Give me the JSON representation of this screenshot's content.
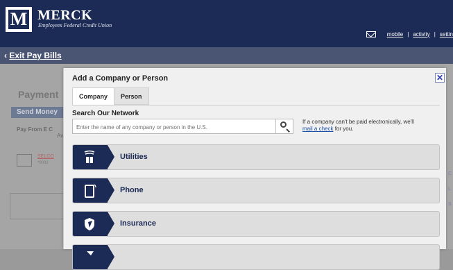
{
  "header": {
    "brand_name": "MERCK",
    "brand_sub": "Employees Federal Credit Union",
    "logo_letter": "M",
    "links": [
      "mobile",
      "activity",
      "settin"
    ],
    "colors": {
      "navy": "#1c2b55",
      "subbar": "#4a5573"
    }
  },
  "subbar": {
    "exit_label": "Exit Pay Bills"
  },
  "background_page": {
    "title": "Payment",
    "send_tab": "Send Money",
    "pay_from": "Pay From  E C",
    "pay_from_sub": "Ava",
    "payee_link": "SELCO",
    "payee_sub": "*9002"
  },
  "modal": {
    "title": "Add a Company or Person",
    "tabs": [
      {
        "label": "Company",
        "active": true
      },
      {
        "label": "Person",
        "active": false
      }
    ],
    "search_heading": "Search Our Network",
    "search_placeholder": "Enter the name of any company or person in the U.S.",
    "helper_text_before": "If a company can't be paid electronically, we'll",
    "helper_link": "mail a check",
    "helper_text_after": "for you.",
    "close_label": "✕",
    "categories": [
      {
        "label": "Utilities",
        "icon": "utilities-icon"
      },
      {
        "label": "Phone",
        "icon": "phone-icon"
      },
      {
        "label": "Insurance",
        "icon": "insurance-icon"
      },
      {
        "label": "",
        "icon": "category-icon"
      }
    ]
  }
}
